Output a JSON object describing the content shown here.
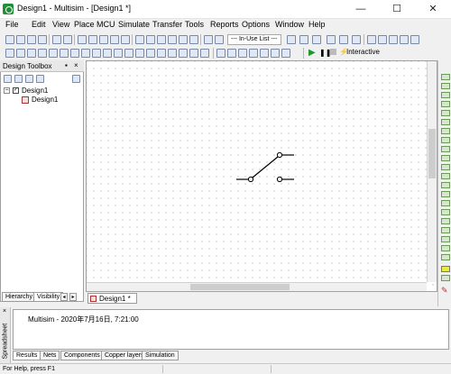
{
  "window": {
    "title": "Design1 - Multisim - [Design1 *]",
    "minimize": "—",
    "maximize": "☐",
    "close": "✕"
  },
  "menu": [
    "File",
    "Edit",
    "View",
    "Place",
    "MCU",
    "Simulate",
    "Transfer",
    "Tools",
    "Reports",
    "Options",
    "Window",
    "Help"
  ],
  "toolbar": {
    "in_use_list": "--- In-Use List ---",
    "interactive_label": "Interactive"
  },
  "design_toolbox": {
    "title": "Design Toolbox",
    "tree_root": "Design1",
    "tree_child": "Design1",
    "tabs": [
      "Hierarchy",
      "Visibility"
    ]
  },
  "workspace": {
    "tab_label": "Design1 *"
  },
  "spreadsheet": {
    "side_label": "Spreadsheet",
    "log_line": "Multisim  -  2020年7月16日, 7:21:00",
    "tabs": [
      "Results",
      "Nets",
      "Components",
      "Copper layers",
      "Simulation"
    ]
  },
  "status": {
    "text": "For Help, press F1"
  },
  "colors": {
    "accent": "#1f8f3a",
    "grid_dot": "#9a9a9a",
    "switch_line": "#000000"
  }
}
